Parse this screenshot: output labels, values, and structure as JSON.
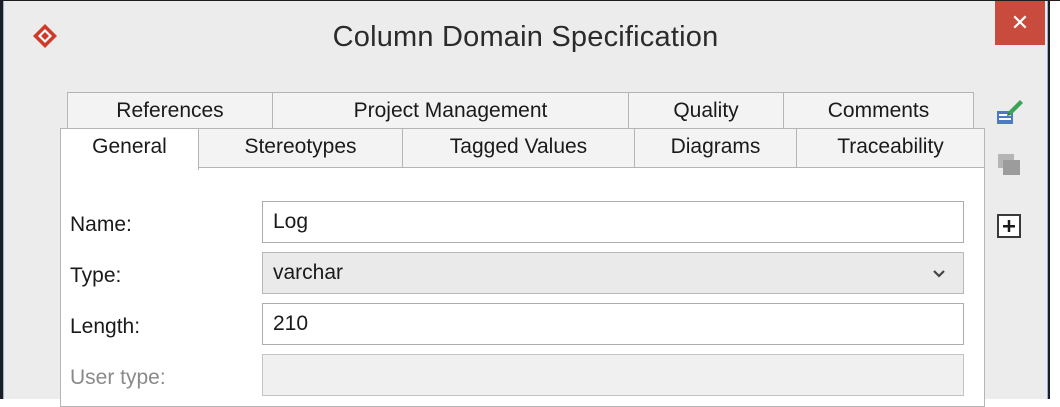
{
  "window": {
    "title": "Column Domain Specification",
    "close_glyph": "✕"
  },
  "tabs": {
    "row1": [
      "References",
      "Project Management",
      "Quality",
      "Comments"
    ],
    "row2": [
      "General",
      "Stereotypes",
      "Tagged Values",
      "Diagrams",
      "Traceability"
    ],
    "active": "General"
  },
  "form": {
    "name_label": "Name:",
    "name_value": "Log",
    "type_label": "Type:",
    "type_value": "varchar",
    "length_label": "Length:",
    "length_value": "210",
    "user_type_label": "User type:",
    "user_type_value": ""
  },
  "side_toolbar": {
    "icons": [
      "edit-pin-icon",
      "stack-icon",
      "add-icon"
    ]
  },
  "colors": {
    "close_button": "#c94b3d",
    "app_icon": "#d03a2a",
    "window_background": "#ececec"
  }
}
